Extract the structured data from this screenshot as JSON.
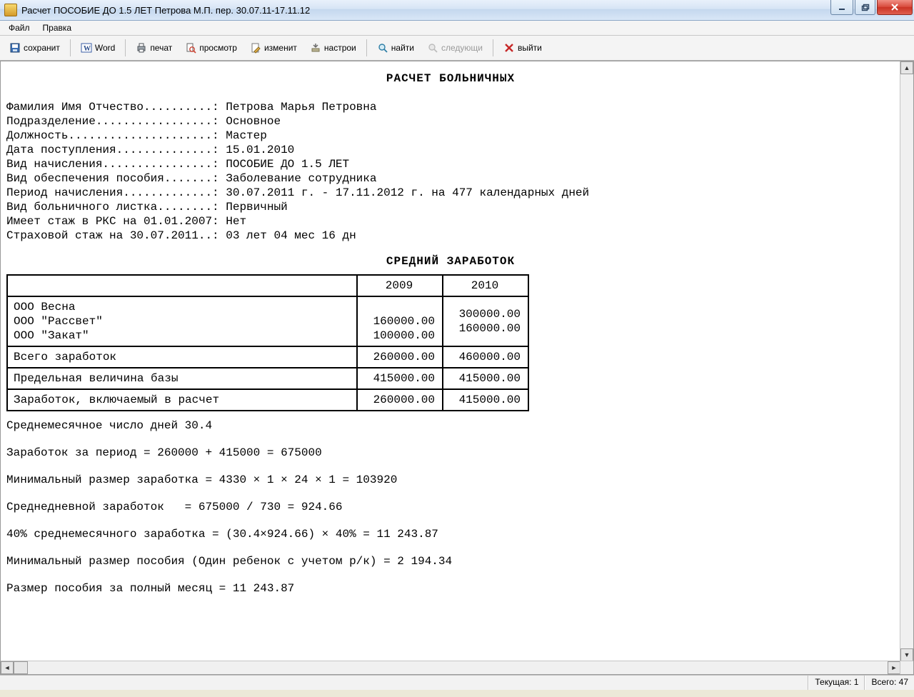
{
  "window": {
    "title": "Расчет ПОСОБИЕ ДО 1.5 ЛЕТ Петрова М.П. пер. 30.07.11-17.11.12"
  },
  "menubar": {
    "file": "Файл",
    "edit": "Правка"
  },
  "toolbar": {
    "save": "сохранит",
    "word": "Word",
    "print": "печат",
    "preview": "просмотр",
    "edit": "изменит",
    "settings": "настрои",
    "find": "найти",
    "next": "следующи",
    "exit": "выйти"
  },
  "doc": {
    "title": "РАСЧЕТ БОЛЬНИЧНЫХ",
    "fields": {
      "fio": "Фамилия Имя Отчество..........: Петрова Марья Петровна",
      "dept": "Подразделение.................: Основное",
      "position": "Должность.....................: Мастер",
      "hire": "Дата поступления..............: 15.01.2010",
      "accrual": "Вид начисления................: ПОСОБИЕ ДО 1.5 ЛЕТ",
      "provision": "Вид обеспечения пособия.......: Заболевание сотрудника",
      "period": "Период начисления.............: 30.07.2011 г. - 17.11.2012 г. на 477 календарных дней",
      "sheet": "Вид больничного листка........: Первичный",
      "rks": "Имеет стаж в РКС на 01.01.2007: Нет",
      "exper": "Страховой стаж на 30.07.2011..: 03 лет 04 мес 16 дн"
    },
    "avg_title": "СРЕДНИЙ  ЗАРАБОТОК",
    "table": {
      "years": [
        "2009",
        "2010"
      ],
      "rows": [
        {
          "label": "ООО Весна",
          "y1": "",
          "y2": "300000.00"
        },
        {
          "label": "ООО \"Рассвет\"",
          "y1": "160000.00",
          "y2": "160000.00"
        },
        {
          "label": "ООО \"Закат\"",
          "y1": "100000.00",
          "y2": ""
        }
      ],
      "total": {
        "label": "Всего заработок",
        "y1": "260000.00",
        "y2": "460000.00"
      },
      "limit": {
        "label": "Предельная величина базы",
        "y1": "415000.00",
        "y2": "415000.00"
      },
      "included": {
        "label": "Заработок, включаемый в расчет",
        "y1": "260000.00",
        "y2": "415000.00"
      }
    },
    "calc": {
      "avg_days": "Среднемесячное число дней 30.4",
      "earn_period": "Заработок за период = 260000 + 415000 = 675000",
      "min_earn": "Минимальный размер заработка = 4330 × 1 × 24 × 1 = 103920",
      "daily": "Среднедневной заработок   = 675000 / 730 = 924.66",
      "forty": "40% среднемесячного заработка = (30.4×924.66) × 40% = 11 243.87",
      "min_benefit": "Минимальный размер пособия (Один ребенок с учетом р/к) = 2 194.34",
      "full_month": "Размер пособия за полный месяц = 11 243.87"
    }
  },
  "status": {
    "current_label": "Текущая:",
    "current_value": "1",
    "total_label": "Всего:",
    "total_value": "47"
  }
}
